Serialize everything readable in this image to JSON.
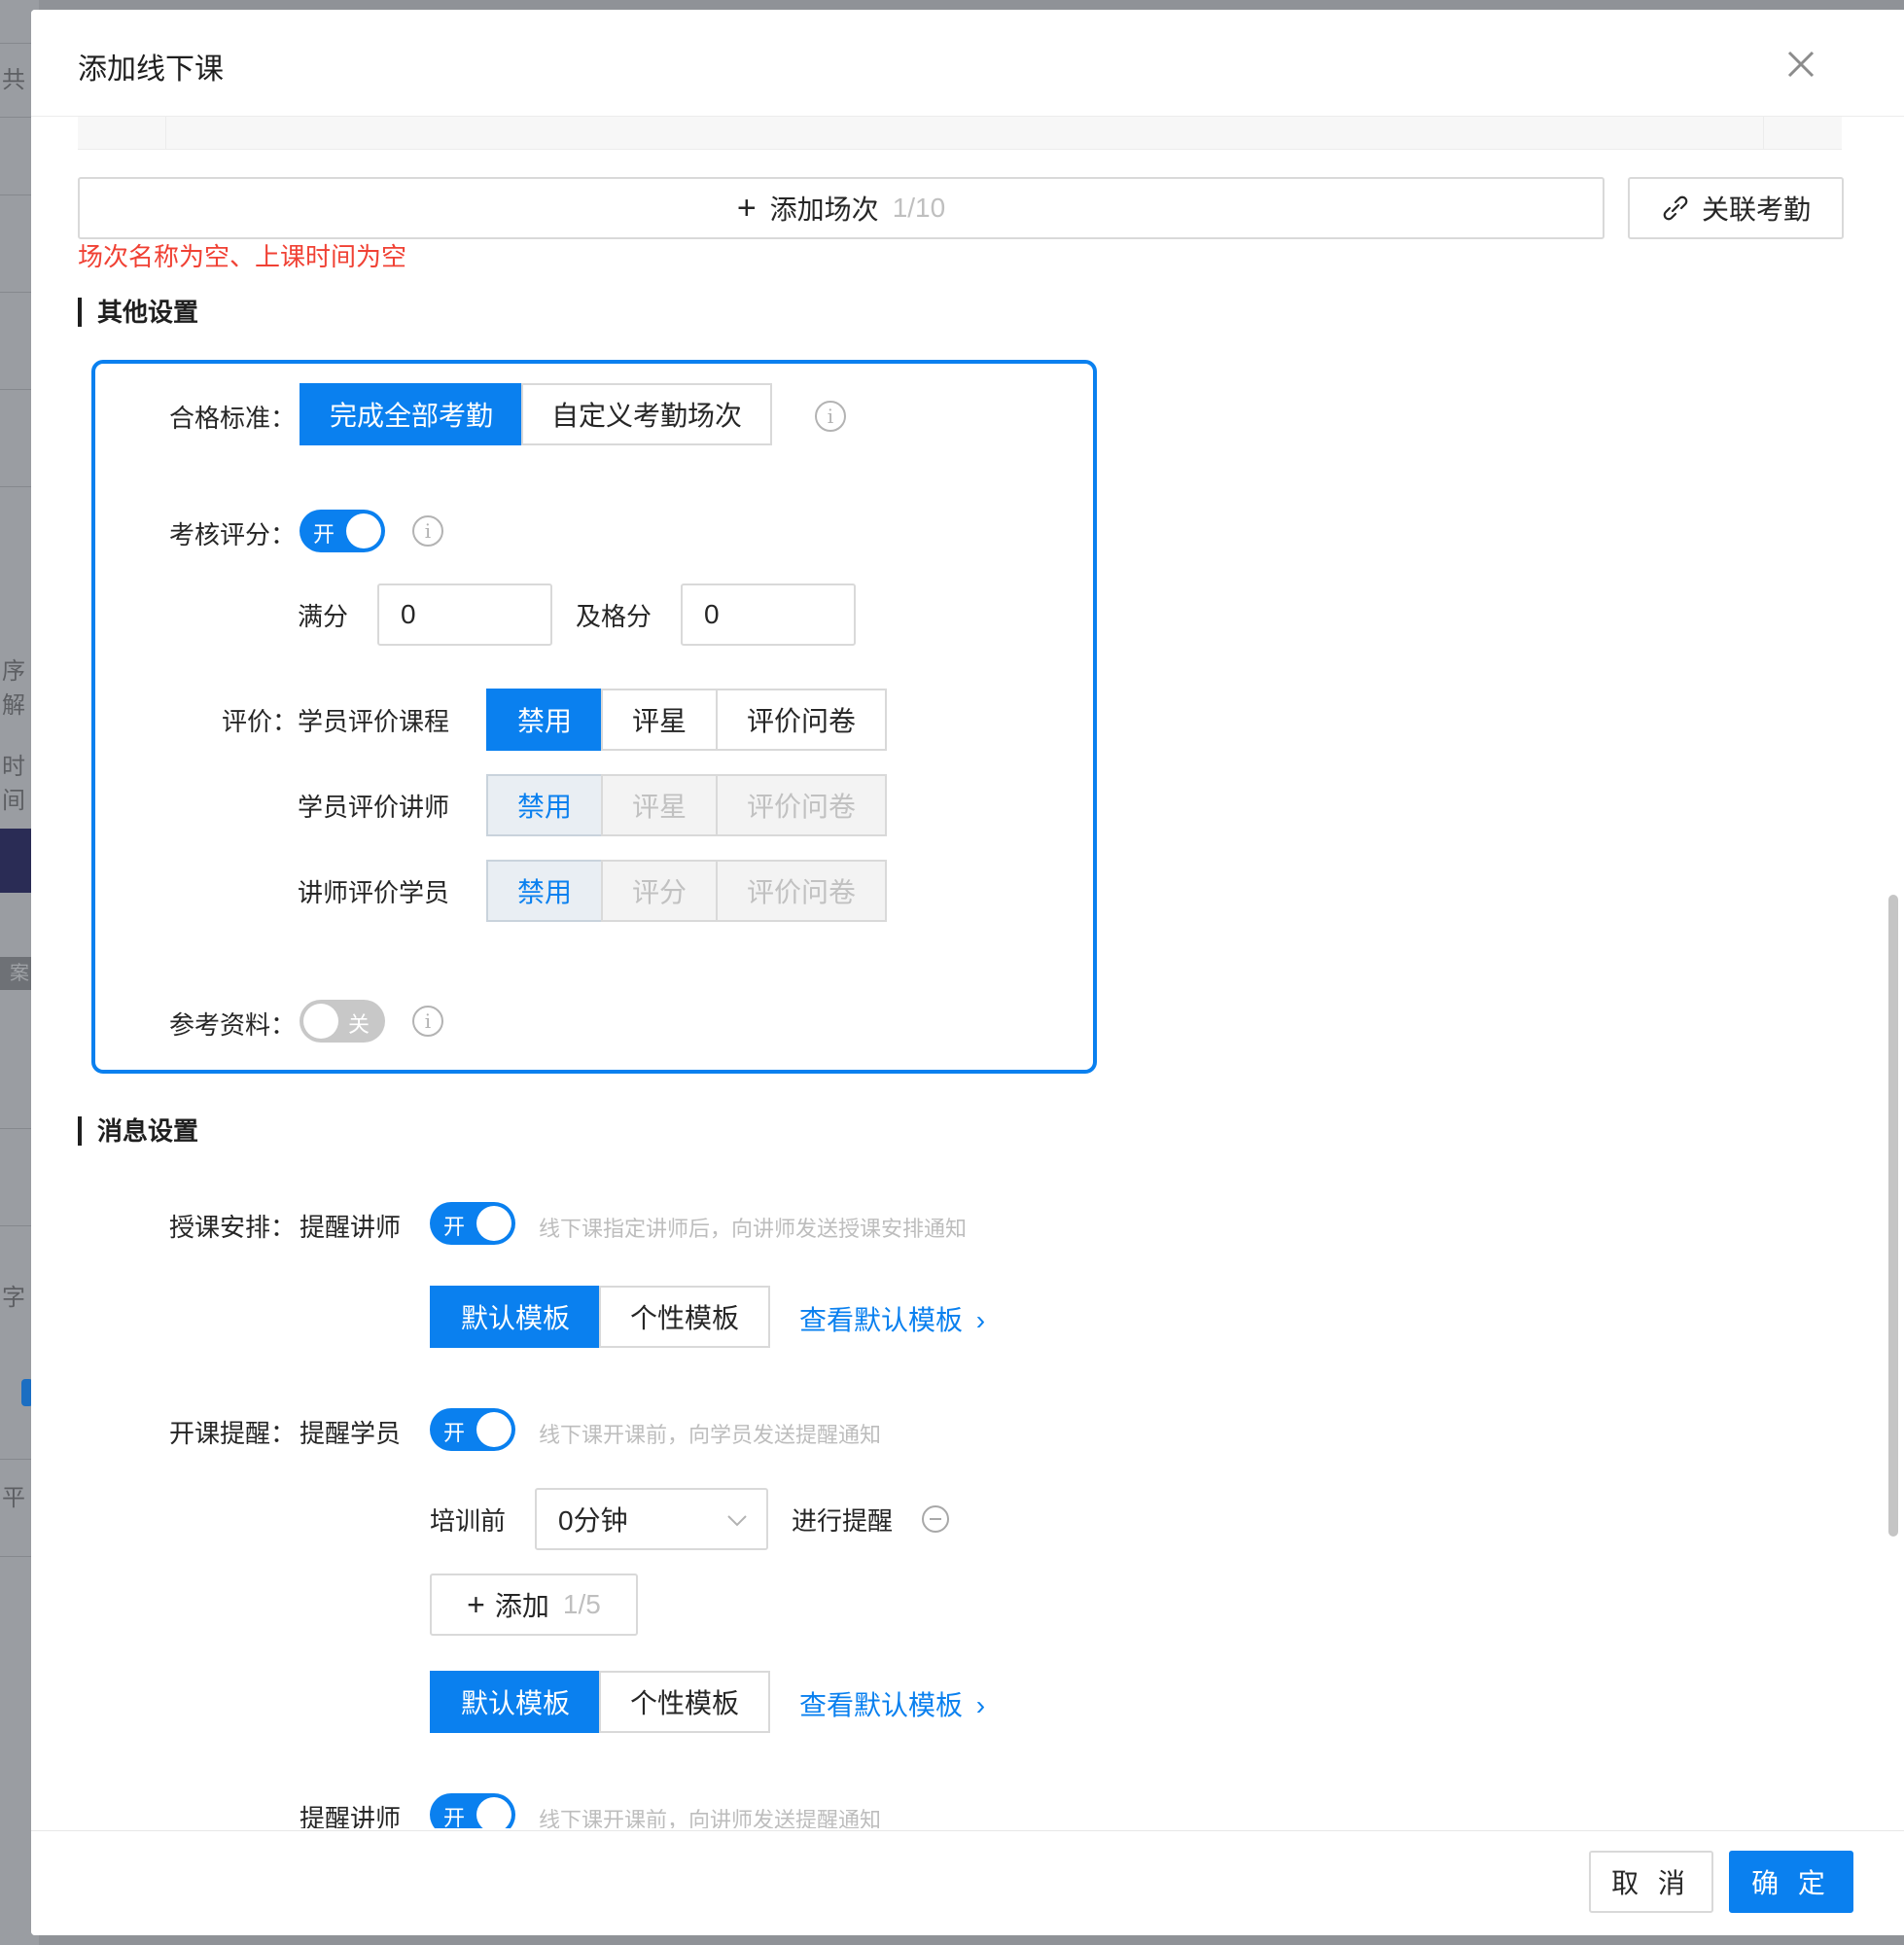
{
  "background": {
    "fragments": [
      "共",
      "序解",
      "时间",
      "案",
      "字",
      "平"
    ]
  },
  "drawer": {
    "title": "添加线下课",
    "close_icon": "close-icon"
  },
  "sessions": {
    "add_label": "添加场次",
    "add_count": "1/10",
    "attendance_label": "关联考勤",
    "error_text": "场次名称为空、上课时间为空"
  },
  "other_settings": {
    "title": "其他设置",
    "pass_standard": {
      "label": "合格标准：",
      "options": [
        "完成全部考勤",
        "自定义考勤场次"
      ],
      "selected": "完成全部考勤"
    },
    "scoring": {
      "label": "考核评分：",
      "toggle_text": "开",
      "full_score_label": "满分",
      "full_score_value": "0",
      "pass_score_label": "及格分",
      "pass_score_value": "0"
    },
    "evaluation": {
      "label": "评价：",
      "rows": [
        {
          "label": "学员评价课程",
          "options": [
            "禁用",
            "评星",
            "评价问卷"
          ],
          "selected": "禁用",
          "disabled": false
        },
        {
          "label": "学员评价讲师",
          "options": [
            "禁用",
            "评星",
            "评价问卷"
          ],
          "selected": "禁用",
          "disabled": true
        },
        {
          "label": "讲师评价学员",
          "options": [
            "禁用",
            "评分",
            "评价问卷"
          ],
          "selected": "禁用",
          "disabled": true
        }
      ]
    },
    "reference": {
      "label": "参考资料：",
      "toggle_text": "关"
    }
  },
  "message_settings": {
    "title": "消息设置",
    "teaching": {
      "label": "授课安排：",
      "sub_label": "提醒讲师",
      "toggle_text": "开",
      "hint": "线下课指定讲师后，向讲师发送授课安排通知",
      "templates": [
        "默认模板",
        "个性模板"
      ],
      "selected": "默认模板",
      "view_link": "查看默认模板"
    },
    "start_reminder": {
      "label": "开课提醒：",
      "sub_label": "提醒学员",
      "toggle_text": "开",
      "hint": "线下课开课前，向学员发送提醒通知",
      "before_label": "培训前",
      "before_value": "0分钟",
      "after_label": "进行提醒",
      "add_label": "添加",
      "add_count": "1/5",
      "templates": [
        "默认模板",
        "个性模板"
      ],
      "selected": "默认模板",
      "view_link": "查看默认模板"
    },
    "lecturer_reminder": {
      "sub_label": "提醒讲师",
      "toggle_text": "开",
      "hint": "线下课开课前，向讲师发送提醒通知"
    }
  },
  "footer": {
    "cancel_label": "取 消",
    "confirm_label": "确 定"
  },
  "colors": {
    "primary": "#0a80ef",
    "error": "#f04134",
    "focus_border": "#0a80ef"
  }
}
